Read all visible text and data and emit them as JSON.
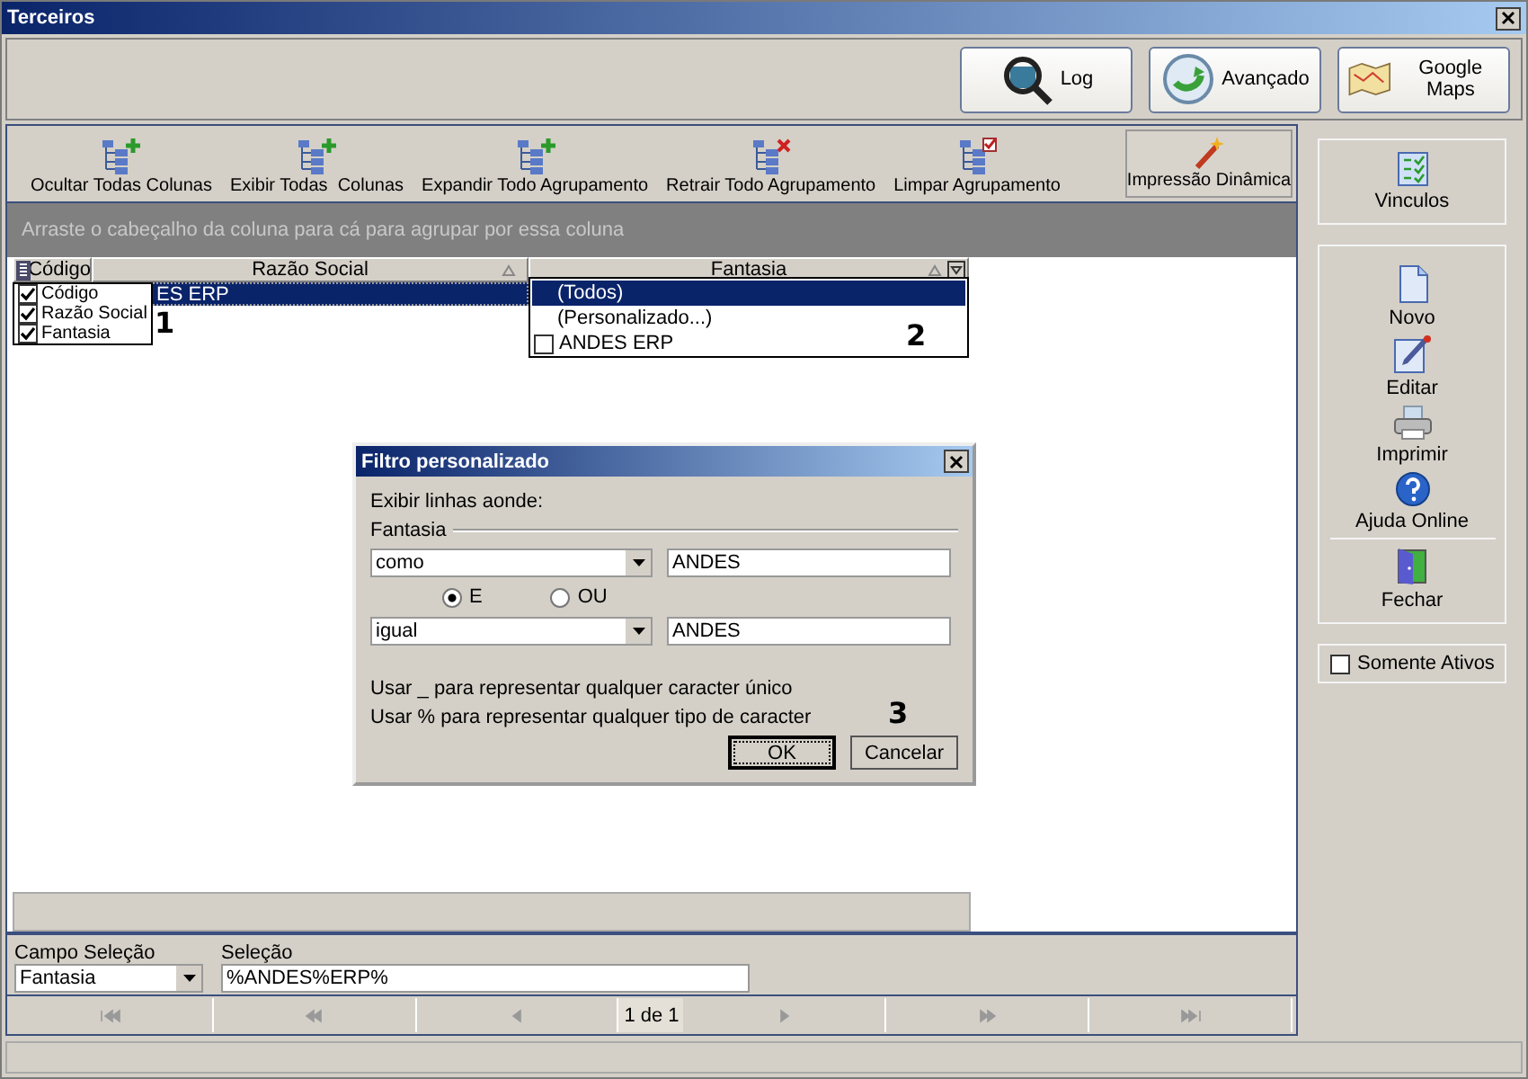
{
  "window": {
    "title": "Terceiros"
  },
  "top_buttons": [
    {
      "label": "Log"
    },
    {
      "label": "Avançado"
    },
    {
      "label": "Google Maps"
    }
  ],
  "toolbar": {
    "items": [
      {
        "label": "Ocultar Todas Colunas"
      },
      {
        "label": "Exibir Todas  Colunas"
      },
      {
        "label": "Expandir Todo Agrupamento"
      },
      {
        "label": "Retrair Todo Agrupamento"
      },
      {
        "label": "Limpar Agrupamento"
      }
    ],
    "print_button": "Impressão Dinâmica"
  },
  "group_panel": {
    "hint": "Arraste o cabeçalho da coluna para cá para agrupar por essa coluna"
  },
  "grid": {
    "columns": [
      {
        "label": "Código",
        "sort_arrow": false
      },
      {
        "label": "Razão Social",
        "sort_arrow": true
      },
      {
        "label": "Fantasia",
        "sort_arrow": true
      }
    ],
    "rows": [
      {
        "cell": "ES ERP",
        "selected": true
      }
    ]
  },
  "column_chooser": {
    "items": [
      {
        "label": "Código",
        "checked": true
      },
      {
        "label": "Razão Social",
        "checked": true
      },
      {
        "label": "Fantasia",
        "checked": true
      }
    ],
    "callout": "1"
  },
  "filter_dropdown": {
    "items": [
      {
        "kind": "option",
        "label": "(Todos)",
        "selected": true
      },
      {
        "kind": "option",
        "label": "(Personalizado...)",
        "selected": false
      },
      {
        "kind": "checkbox",
        "label": "ANDES ERP",
        "selected": false,
        "checked": false
      }
    ],
    "callout": "2"
  },
  "dialog": {
    "title": "Filtro personalizado",
    "prompt": "Exibir linhas aonde:",
    "group_label": "Fantasia",
    "conditions": [
      {
        "operator": "como",
        "value": "ANDES"
      },
      {
        "operator": "igual",
        "value": "ANDES"
      }
    ],
    "logic": [
      {
        "label": "E",
        "selected": true
      },
      {
        "label": "OU",
        "selected": false
      }
    ],
    "hints": [
      "Usar _ para representar qualquer caracter único",
      "Usar % para representar qualquer tipo de caracter"
    ],
    "buttons": [
      {
        "label": "OK",
        "default": true
      },
      {
        "label": "Cancelar",
        "default": false
      }
    ],
    "callout": "3"
  },
  "selection_bar": {
    "field_label": "Campo Seleção",
    "field_value": "Fantasia",
    "selection_label": "Seleção",
    "selection_value": "%ANDES%ERP%"
  },
  "navigator": {
    "page": "1 de 1"
  },
  "sidebar": {
    "links": [
      {
        "label": "Vinculos"
      }
    ],
    "actions": [
      {
        "label": "Novo",
        "separator_before": false
      },
      {
        "label": "Editar",
        "separator_before": false
      },
      {
        "label": "Imprimir",
        "separator_before": false
      },
      {
        "label": "Ajuda Online",
        "separator_before": false
      },
      {
        "label": "Fechar",
        "separator_before": true
      }
    ],
    "filter": {
      "label": "Somente Ativos",
      "checked": false
    }
  }
}
